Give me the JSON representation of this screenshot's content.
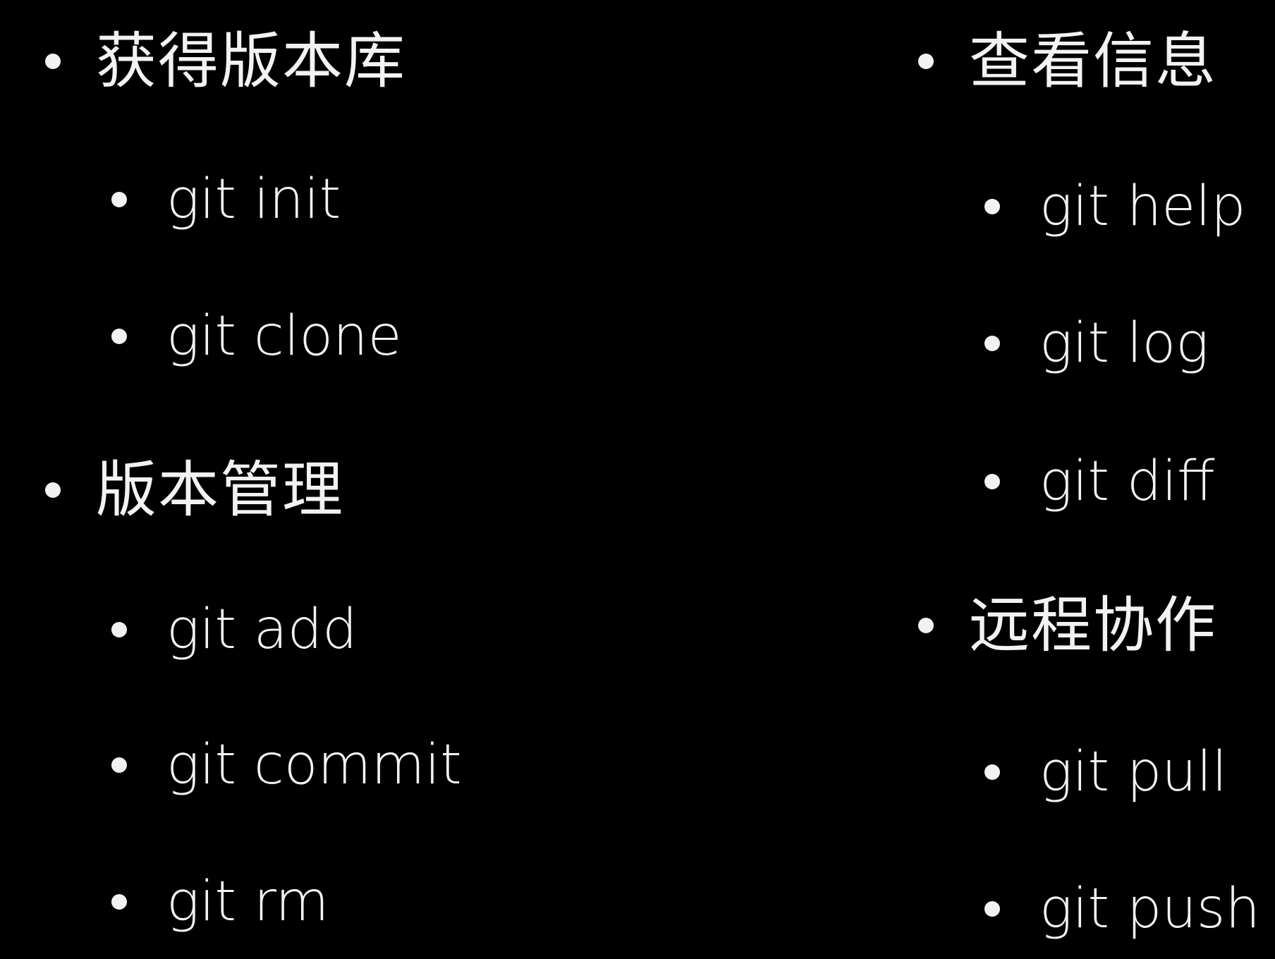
{
  "left_column": {
    "sections": [
      {
        "title": "获得版本库",
        "commands": [
          "git init",
          "git clone"
        ]
      },
      {
        "title": "版本管理",
        "commands": [
          "git add",
          "git commit",
          "git rm"
        ]
      }
    ]
  },
  "right_column": {
    "sections": [
      {
        "title": "查看信息",
        "commands": [
          "git help",
          "git log",
          "git diff"
        ]
      },
      {
        "title": "远程协作",
        "commands": [
          "git pull",
          "git push"
        ]
      }
    ]
  },
  "colors": {
    "background": "#000000",
    "text": "#f2f2f2"
  }
}
